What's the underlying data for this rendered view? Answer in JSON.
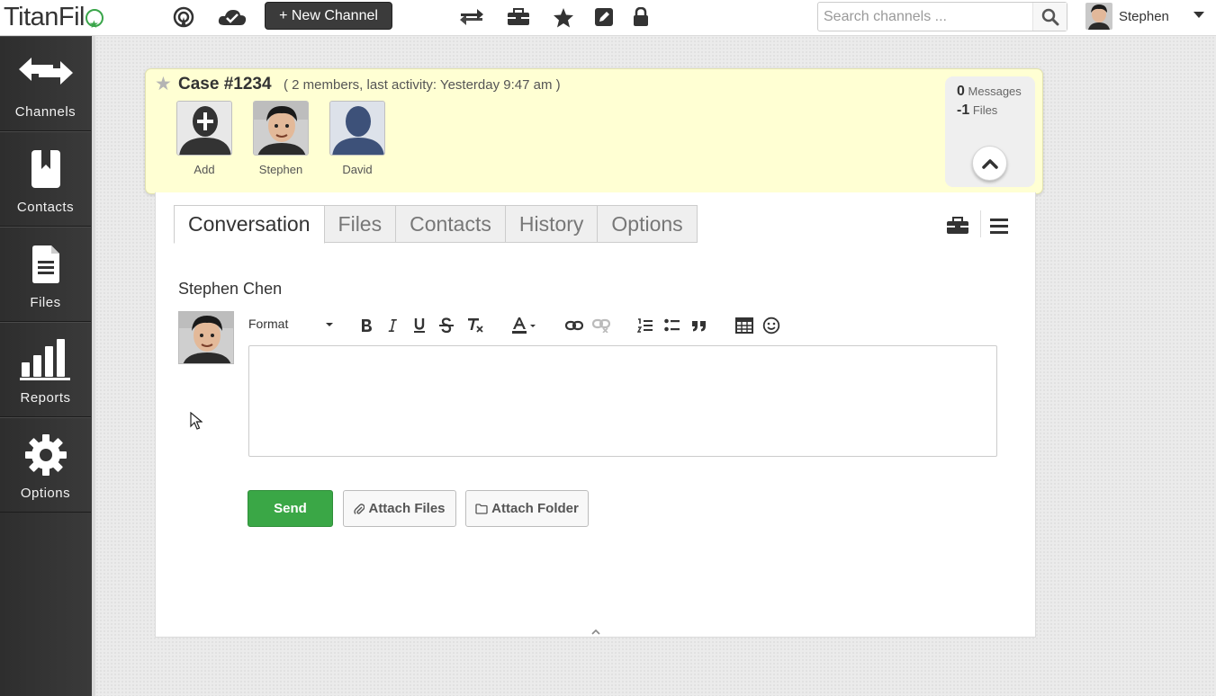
{
  "app": {
    "logo_text": "TitanFil",
    "new_channel_label": "+ New Channel",
    "search_placeholder": "Search channels ...",
    "user_name": "Stephen"
  },
  "sidebar": {
    "items": [
      {
        "label": "Channels",
        "icon": "arrows-exchange-icon"
      },
      {
        "label": "Contacts",
        "icon": "contact-book-icon"
      },
      {
        "label": "Files",
        "icon": "file-icon"
      },
      {
        "label": "Reports",
        "icon": "bar-chart-icon"
      },
      {
        "label": "Options",
        "icon": "gear-icon"
      }
    ]
  },
  "channel": {
    "title": "Case #1234",
    "meta": "( 2 members, last activity: Yesterday 9:47 am )",
    "members": [
      {
        "name": "Add"
      },
      {
        "name": "Stephen"
      },
      {
        "name": "David"
      }
    ],
    "stats": {
      "messages_count": "0",
      "messages_label": "Messages",
      "files_count": "-1",
      "files_label": "Files"
    }
  },
  "tabs": [
    {
      "label": "Conversation",
      "active": true
    },
    {
      "label": "Files",
      "active": false
    },
    {
      "label": "Contacts",
      "active": false
    },
    {
      "label": "History",
      "active": false
    },
    {
      "label": "Options",
      "active": false
    }
  ],
  "composer": {
    "author": "Stephen Chen",
    "format_label": "Format",
    "send_label": "Send",
    "attach_files_label": "Attach Files",
    "attach_folder_label": "Attach Folder"
  },
  "colors": {
    "send_green": "#3aa746",
    "header_yellow": "#ffffd3",
    "sidebar_dark": "#333333",
    "brand_green": "#3aa54a"
  }
}
